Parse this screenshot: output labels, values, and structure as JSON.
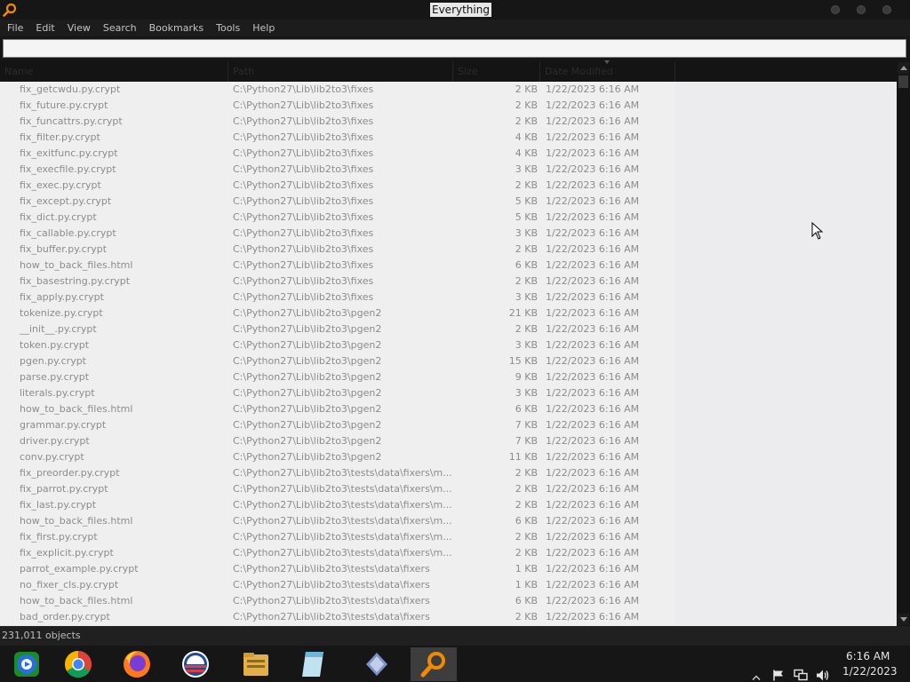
{
  "window": {
    "title": "Everything"
  },
  "menu": [
    "File",
    "Edit",
    "View",
    "Search",
    "Bookmarks",
    "Tools",
    "Help"
  ],
  "search": {
    "value": ""
  },
  "columns": [
    {
      "label": "Name"
    },
    {
      "label": "Path"
    },
    {
      "label": "Size"
    },
    {
      "label": "Date Modified"
    }
  ],
  "rows": [
    {
      "name": "fix_getcwdu.py.crypt",
      "path": "C:\\Python27\\Lib\\lib2to3\\fixes",
      "size": "2 KB",
      "date": "1/22/2023 6:16 AM",
      "icon": "file-icon"
    },
    {
      "name": "fix_future.py.crypt",
      "path": "C:\\Python27\\Lib\\lib2to3\\fixes",
      "size": "2 KB",
      "date": "1/22/2023 6:16 AM",
      "icon": "file-icon"
    },
    {
      "name": "fix_funcattrs.py.crypt",
      "path": "C:\\Python27\\Lib\\lib2to3\\fixes",
      "size": "2 KB",
      "date": "1/22/2023 6:16 AM",
      "icon": "file-icon"
    },
    {
      "name": "fix_filter.py.crypt",
      "path": "C:\\Python27\\Lib\\lib2to3\\fixes",
      "size": "4 KB",
      "date": "1/22/2023 6:16 AM",
      "icon": "file-icon"
    },
    {
      "name": "fix_exitfunc.py.crypt",
      "path": "C:\\Python27\\Lib\\lib2to3\\fixes",
      "size": "4 KB",
      "date": "1/22/2023 6:16 AM",
      "icon": "file-icon"
    },
    {
      "name": "fix_execfile.py.crypt",
      "path": "C:\\Python27\\Lib\\lib2to3\\fixes",
      "size": "3 KB",
      "date": "1/22/2023 6:16 AM",
      "icon": "file-icon"
    },
    {
      "name": "fix_exec.py.crypt",
      "path": "C:\\Python27\\Lib\\lib2to3\\fixes",
      "size": "2 KB",
      "date": "1/22/2023 6:16 AM",
      "icon": "file-icon"
    },
    {
      "name": "fix_except.py.crypt",
      "path": "C:\\Python27\\Lib\\lib2to3\\fixes",
      "size": "5 KB",
      "date": "1/22/2023 6:16 AM",
      "icon": "file-icon"
    },
    {
      "name": "fix_dict.py.crypt",
      "path": "C:\\Python27\\Lib\\lib2to3\\fixes",
      "size": "5 KB",
      "date": "1/22/2023 6:16 AM",
      "icon": "file-icon"
    },
    {
      "name": "fix_callable.py.crypt",
      "path": "C:\\Python27\\Lib\\lib2to3\\fixes",
      "size": "3 KB",
      "date": "1/22/2023 6:16 AM",
      "icon": "file-icon"
    },
    {
      "name": "fix_buffer.py.crypt",
      "path": "C:\\Python27\\Lib\\lib2to3\\fixes",
      "size": "2 KB",
      "date": "1/22/2023 6:16 AM",
      "icon": "file-icon"
    },
    {
      "name": "how_to_back_files.html",
      "path": "C:\\Python27\\Lib\\lib2to3\\fixes",
      "size": "6 KB",
      "date": "1/22/2023 6:16 AM",
      "icon": "chrome-html-icon"
    },
    {
      "name": "fix_basestring.py.crypt",
      "path": "C:\\Python27\\Lib\\lib2to3\\fixes",
      "size": "2 KB",
      "date": "1/22/2023 6:16 AM",
      "icon": "file-icon"
    },
    {
      "name": "fix_apply.py.crypt",
      "path": "C:\\Python27\\Lib\\lib2to3\\fixes",
      "size": "3 KB",
      "date": "1/22/2023 6:16 AM",
      "icon": "file-icon"
    },
    {
      "name": "tokenize.py.crypt",
      "path": "C:\\Python27\\Lib\\lib2to3\\pgen2",
      "size": "21 KB",
      "date": "1/22/2023 6:16 AM",
      "icon": "file-icon"
    },
    {
      "name": "__init__.py.crypt",
      "path": "C:\\Python27\\Lib\\lib2to3\\pgen2",
      "size": "2 KB",
      "date": "1/22/2023 6:16 AM",
      "icon": "file-icon"
    },
    {
      "name": "token.py.crypt",
      "path": "C:\\Python27\\Lib\\lib2to3\\pgen2",
      "size": "3 KB",
      "date": "1/22/2023 6:16 AM",
      "icon": "file-icon"
    },
    {
      "name": "pgen.py.crypt",
      "path": "C:\\Python27\\Lib\\lib2to3\\pgen2",
      "size": "15 KB",
      "date": "1/22/2023 6:16 AM",
      "icon": "file-icon"
    },
    {
      "name": "parse.py.crypt",
      "path": "C:\\Python27\\Lib\\lib2to3\\pgen2",
      "size": "9 KB",
      "date": "1/22/2023 6:16 AM",
      "icon": "file-icon"
    },
    {
      "name": "literals.py.crypt",
      "path": "C:\\Python27\\Lib\\lib2to3\\pgen2",
      "size": "3 KB",
      "date": "1/22/2023 6:16 AM",
      "icon": "file-icon"
    },
    {
      "name": "how_to_back_files.html",
      "path": "C:\\Python27\\Lib\\lib2to3\\pgen2",
      "size": "6 KB",
      "date": "1/22/2023 6:16 AM",
      "icon": "chrome-html-icon"
    },
    {
      "name": "grammar.py.crypt",
      "path": "C:\\Python27\\Lib\\lib2to3\\pgen2",
      "size": "7 KB",
      "date": "1/22/2023 6:16 AM",
      "icon": "file-icon"
    },
    {
      "name": "driver.py.crypt",
      "path": "C:\\Python27\\Lib\\lib2to3\\pgen2",
      "size": "7 KB",
      "date": "1/22/2023 6:16 AM",
      "icon": "file-icon"
    },
    {
      "name": "conv.py.crypt",
      "path": "C:\\Python27\\Lib\\lib2to3\\pgen2",
      "size": "11 KB",
      "date": "1/22/2023 6:16 AM",
      "icon": "file-icon"
    },
    {
      "name": "fix_preorder.py.crypt",
      "path": "C:\\Python27\\Lib\\lib2to3\\tests\\data\\fixers\\m...",
      "size": "2 KB",
      "date": "1/22/2023 6:16 AM",
      "icon": "file-icon"
    },
    {
      "name": "fix_parrot.py.crypt",
      "path": "C:\\Python27\\Lib\\lib2to3\\tests\\data\\fixers\\m...",
      "size": "2 KB",
      "date": "1/22/2023 6:16 AM",
      "icon": "file-icon"
    },
    {
      "name": "fix_last.py.crypt",
      "path": "C:\\Python27\\Lib\\lib2to3\\tests\\data\\fixers\\m...",
      "size": "2 KB",
      "date": "1/22/2023 6:16 AM",
      "icon": "file-icon"
    },
    {
      "name": "how_to_back_files.html",
      "path": "C:\\Python27\\Lib\\lib2to3\\tests\\data\\fixers\\m...",
      "size": "6 KB",
      "date": "1/22/2023 6:16 AM",
      "icon": "chrome-html-icon"
    },
    {
      "name": "fix_first.py.crypt",
      "path": "C:\\Python27\\Lib\\lib2to3\\tests\\data\\fixers\\m...",
      "size": "2 KB",
      "date": "1/22/2023 6:16 AM",
      "icon": "file-icon"
    },
    {
      "name": "fix_explicit.py.crypt",
      "path": "C:\\Python27\\Lib\\lib2to3\\tests\\data\\fixers\\m...",
      "size": "2 KB",
      "date": "1/22/2023 6:16 AM",
      "icon": "file-icon"
    },
    {
      "name": "parrot_example.py.crypt",
      "path": "C:\\Python27\\Lib\\lib2to3\\tests\\data\\fixers",
      "size": "1 KB",
      "date": "1/22/2023 6:16 AM",
      "icon": "file-icon"
    },
    {
      "name": "no_fixer_cls.py.crypt",
      "path": "C:\\Python27\\Lib\\lib2to3\\tests\\data\\fixers",
      "size": "1 KB",
      "date": "1/22/2023 6:16 AM",
      "icon": "file-icon"
    },
    {
      "name": "how_to_back_files.html",
      "path": "C:\\Python27\\Lib\\lib2to3\\tests\\data\\fixers",
      "size": "6 KB",
      "date": "1/22/2023 6:16 AM",
      "icon": "chrome-html-icon"
    },
    {
      "name": "bad_order.py.crypt",
      "path": "C:\\Python27\\Lib\\lib2to3\\tests\\data\\fixers",
      "size": "2 KB",
      "date": "1/22/2023 6:16 AM",
      "icon": "file-icon"
    }
  ],
  "status": {
    "text": "231,011 objects"
  },
  "taskbar": {
    "items": [
      {
        "name": "media-center-icon"
      },
      {
        "name": "chrome-icon"
      },
      {
        "name": "firefox-icon"
      },
      {
        "name": "obama-logo-icon"
      },
      {
        "name": "file-explorer-icon"
      },
      {
        "name": "notepad-icon"
      },
      {
        "name": "network-app-icon"
      },
      {
        "name": "everything-search-icon"
      }
    ],
    "clock": {
      "time": "6:16 AM",
      "date": "1/22/2023"
    }
  },
  "colors": {
    "accent": "#f08a00",
    "list_bg": "#eaeaec",
    "chrome_dark": "#161616"
  }
}
